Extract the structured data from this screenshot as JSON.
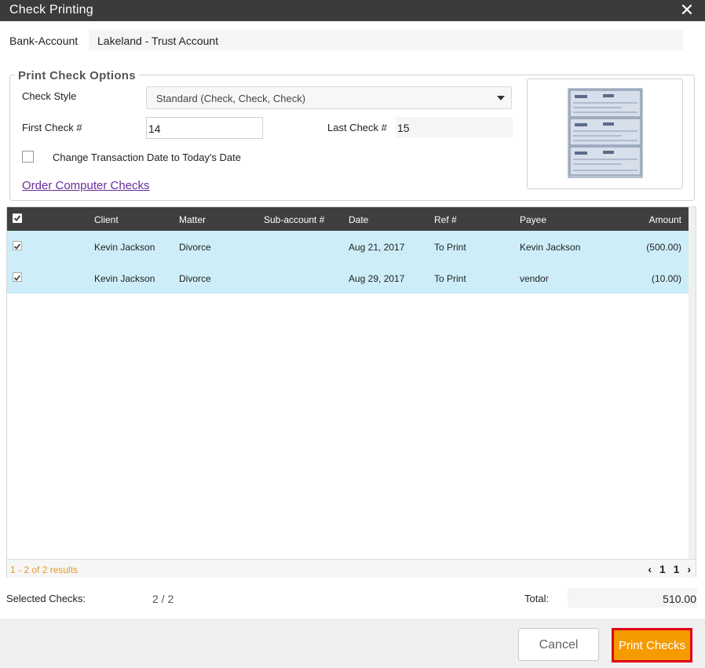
{
  "window": {
    "title": "Check Printing",
    "close_icon": "close-icon"
  },
  "bank_account": {
    "label": "Bank-Account",
    "value": "Lakeland - Trust Account"
  },
  "options": {
    "legend": "Print Check Options",
    "check_style_label": "Check Style",
    "check_style_value": "Standard (Check, Check, Check)",
    "first_check_label": "First Check #",
    "first_check_value": "14",
    "last_check_label": "Last Check #",
    "last_check_value": "15",
    "change_date_label": "Change Transaction Date to Today's Date",
    "change_date_checked": false,
    "order_link": "Order Computer Checks"
  },
  "table": {
    "headers": [
      "Client",
      "Matter",
      "Sub-account #",
      "Date",
      "Ref #",
      "Payee",
      "Amount"
    ],
    "rows": [
      {
        "checked": true,
        "client": "Kevin Jackson",
        "matter": "Divorce",
        "subaccount": "",
        "date": "Aug 21, 2017",
        "ref": "To Print",
        "payee": "Kevin Jackson",
        "amount": "(500.00)"
      },
      {
        "checked": true,
        "client": "Kevin Jackson",
        "matter": "Divorce",
        "subaccount": "",
        "date": "Aug 29, 2017",
        "ref": "To Print",
        "payee": "vendor",
        "amount": "(10.00)"
      }
    ],
    "results_text": "1 - 2 of 2 results",
    "pager": {
      "prev": "‹",
      "page_a": "1",
      "page_b": "1",
      "next": "›"
    }
  },
  "summary": {
    "selected_label": "Selected Checks:",
    "selected_value": "2 / 2",
    "total_label": "Total:",
    "total_value": "510.00"
  },
  "buttons": {
    "cancel": "Cancel",
    "print": "Print Checks"
  },
  "colors": {
    "titlebar": "#3b3b3b",
    "row_highlight": "#cdeef8",
    "print_button": "#f59b00",
    "print_border": "#e0001a",
    "link": "#6b2d9a"
  }
}
